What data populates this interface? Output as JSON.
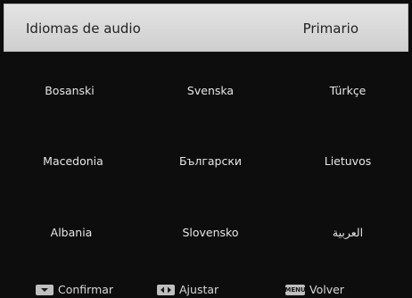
{
  "header": {
    "title": "Idiomas de audio",
    "value": "Primario"
  },
  "languages": [
    "Bosanski",
    "Svenska",
    "Türkçe",
    "Macedonia",
    "Български",
    "Lietuvos",
    "Albania",
    "Slovensko",
    "العربية"
  ],
  "footer": {
    "confirm": {
      "icon": "down-arrow-key-icon",
      "label": "Confirmar"
    },
    "adjust": {
      "icon": "left-right-arrows-key-icon",
      "label": "Ajustar"
    },
    "back": {
      "icon": "menu-key-icon",
      "key_text": "MENU",
      "label": "Volver"
    }
  }
}
